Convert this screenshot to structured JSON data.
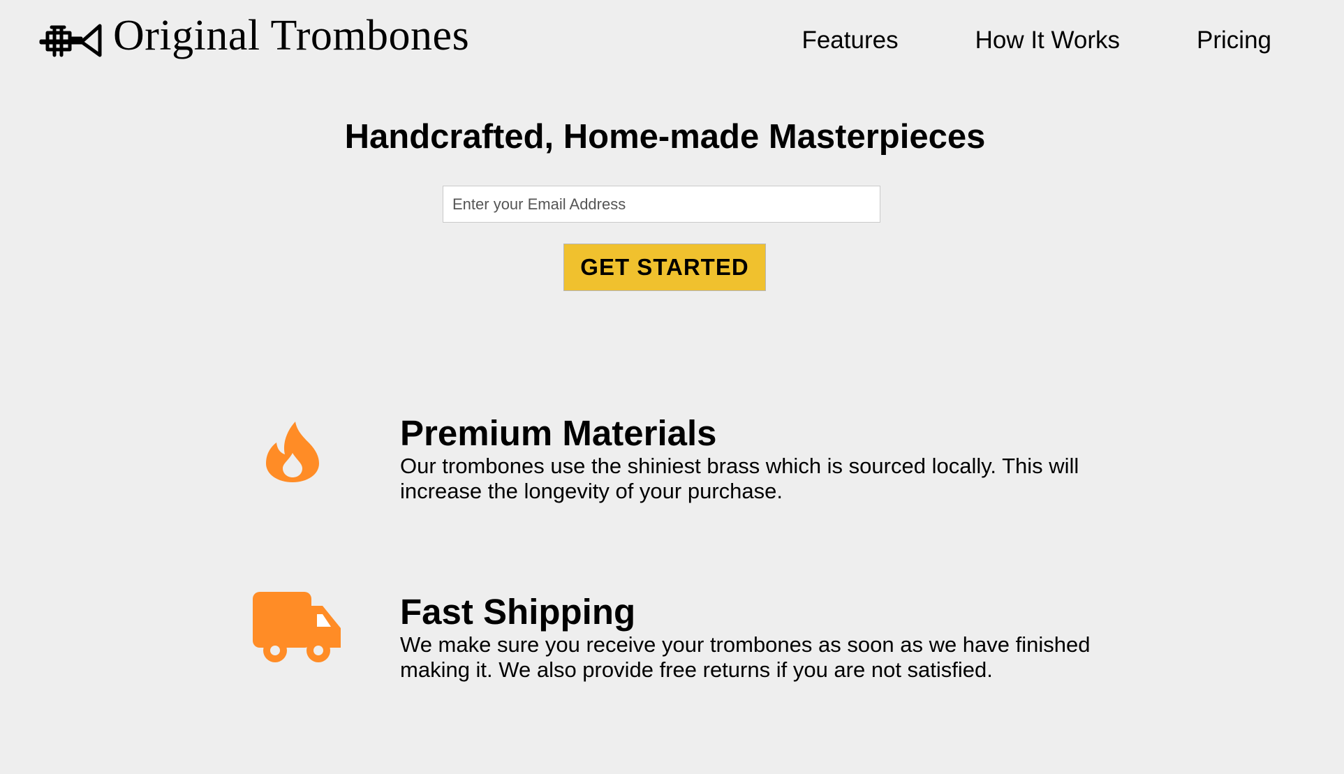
{
  "header": {
    "brand": "Original Trombones",
    "nav": [
      "Features",
      "How It Works",
      "Pricing"
    ]
  },
  "hero": {
    "title": "Handcrafted, Home-made Masterpieces",
    "email_placeholder": "Enter your Email Address",
    "cta_label": "GET STARTED"
  },
  "features": [
    {
      "icon": "fire-icon",
      "title": "Premium Materials",
      "description": "Our trombones use the shiniest brass which is sourced locally. This will increase the longevity of your purchase."
    },
    {
      "icon": "truck-icon",
      "title": "Fast Shipping",
      "description": "We make sure you receive your trombones as soon as we have finished making it. We also provide free returns if you are not satisfied."
    }
  ],
  "colors": {
    "background": "#eeeeee",
    "accent_orange": "#ff8c26",
    "cta_yellow": "#f0c12e"
  }
}
